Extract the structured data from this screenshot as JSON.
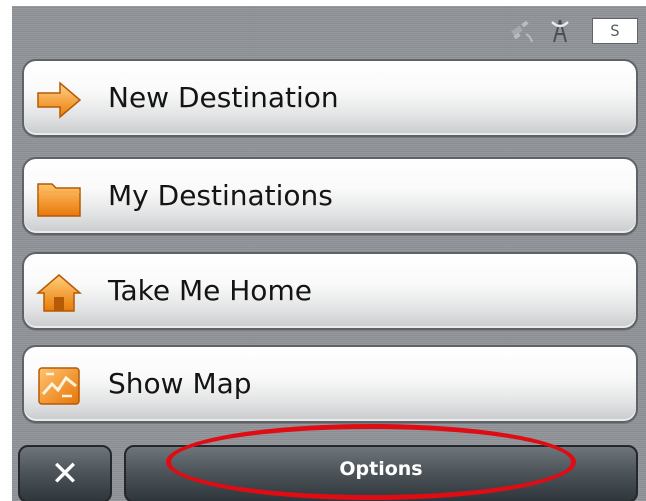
{
  "status": {
    "icons": [
      "satellite-signal-icon",
      "satellite-dish-icon"
    ],
    "gps_badge": "S"
  },
  "menu": {
    "items": [
      {
        "label": "New Destination",
        "icon": "orange-arrow-icon"
      },
      {
        "label": "My Destinations",
        "icon": "folder-icon"
      },
      {
        "label": "Take Me Home",
        "icon": "home-icon"
      },
      {
        "label": "Show Map",
        "icon": "map-icon"
      }
    ]
  },
  "bottom_bar": {
    "close_label": "✕",
    "options_label": "Options"
  },
  "colors": {
    "accent": "#f39a1f",
    "background": "#8f9398",
    "highlight": "#e00c14"
  }
}
